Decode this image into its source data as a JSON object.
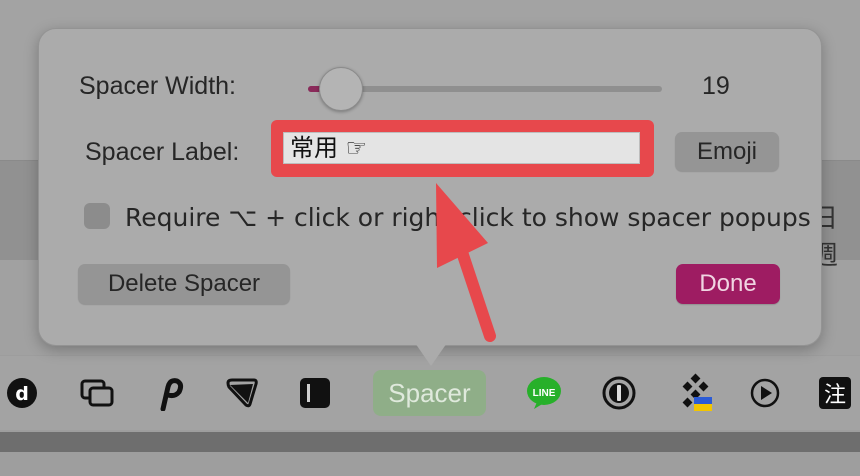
{
  "popover": {
    "spacer_width_label": "Spacer Width:",
    "spacer_width_value": "19",
    "spacer_width_slider": 0.05,
    "spacer_label_label": "Spacer Label:",
    "spacer_label_value": "常用 ☞",
    "emoji_button": "Emoji",
    "require_checkbox_label": "Require ⌥ + click or right click to show spacer popups",
    "require_checkbox_checked": false,
    "delete_button": "Delete Spacer",
    "done_button": "Done",
    "accent_color": "#9e1c62",
    "highlight_color": "#e7484c"
  },
  "menubar": {
    "spacer_label": "Spacer",
    "icons": [
      "d-circle-icon",
      "windows-icon",
      "p-app-icon",
      "flag-app-icon",
      "sidebar-app-icon",
      "line-app-icon",
      "1password-icon",
      "grid-app-icon",
      "play-circle-icon",
      "zhu-app-icon"
    ],
    "zhu_label": "注",
    "line_label": "LINE",
    "d_label": "d"
  },
  "background": {
    "partial_text": "日 週"
  }
}
